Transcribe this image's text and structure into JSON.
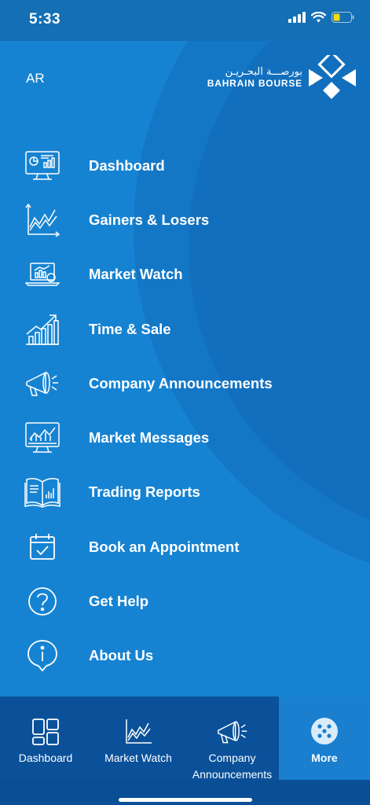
{
  "status_bar": {
    "time": "5:33"
  },
  "header": {
    "language_toggle": "AR",
    "logo_arabic": "بورصـــة البحـريـن",
    "logo_english": "BAHRAIN BOURSE"
  },
  "menu": {
    "items": [
      {
        "label": "Dashboard",
        "icon": "dashboard-monitor-icon"
      },
      {
        "label": "Gainers & Losers",
        "icon": "line-chart-icon"
      },
      {
        "label": "Market Watch",
        "icon": "laptop-chart-icon"
      },
      {
        "label": "Time & Sale",
        "icon": "growth-bar-icon"
      },
      {
        "label": "Company Announcements",
        "icon": "megaphone-icon"
      },
      {
        "label": "Market Messages",
        "icon": "monitor-chart-icon"
      },
      {
        "label": "Trading Reports",
        "icon": "book-report-icon"
      },
      {
        "label": "Book an Appointment",
        "icon": "calendar-check-icon"
      },
      {
        "label": "Get Help",
        "icon": "question-icon"
      },
      {
        "label": "About Us",
        "icon": "info-icon"
      }
    ]
  },
  "tab_bar": {
    "tabs": [
      {
        "label": "Dashboard",
        "icon": "grid-icon"
      },
      {
        "label": "Market Watch",
        "icon": "line-chart-icon"
      },
      {
        "label": "Company Announcements",
        "icon": "megaphone-icon"
      },
      {
        "label": "More",
        "icon": "more-dots-icon",
        "active": true
      }
    ]
  },
  "colors": {
    "background": "#1683d2",
    "tab_bar": "#0a519a",
    "active_tab": "#1a7fcf",
    "status_bar": "#146fb4"
  }
}
